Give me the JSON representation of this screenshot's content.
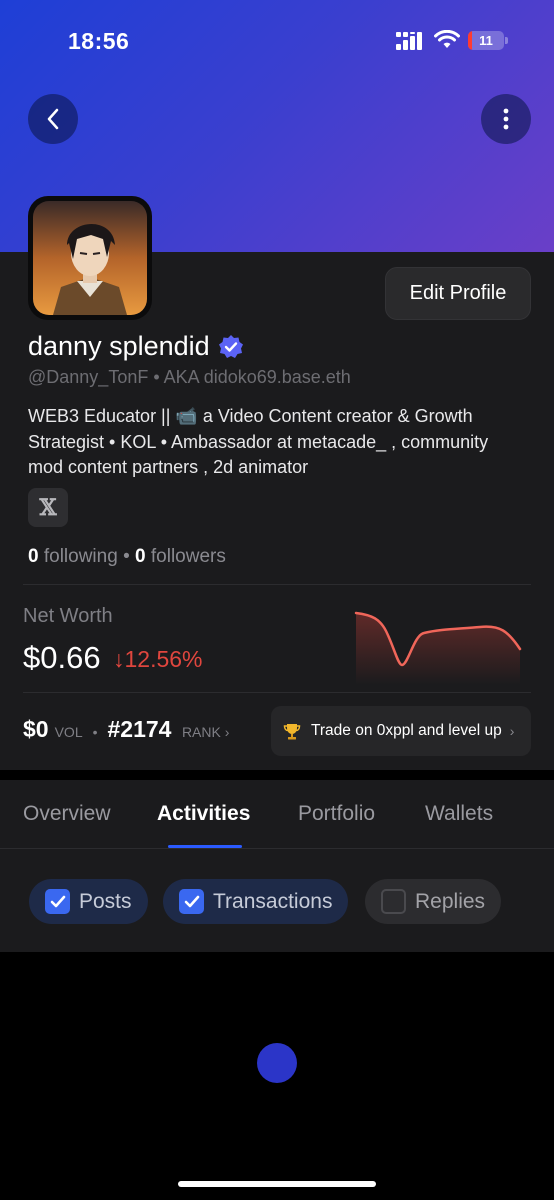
{
  "status_bar": {
    "time": "18:56",
    "battery": "11"
  },
  "profile": {
    "display_name": "danny splendid",
    "handle": "@Danny_TonF",
    "aka": "AKA didoko69.base.eth",
    "bio": "WEB3 Educator || 📹 a Video Content creator & Growth Strategist • KOL • Ambassador at metacade_ , community mod content partners , 2d animator",
    "edit_label": "Edit Profile",
    "social_icon": "x-logo",
    "following_count": "0",
    "following_label": "following",
    "followers_count": "0",
    "followers_label": "followers"
  },
  "net_worth": {
    "label": "Net Worth",
    "value": "$0.66",
    "change": "↓12.56%",
    "change_color": "#e0463e"
  },
  "stats": {
    "vol_value": "$0",
    "vol_label": "VOL",
    "rank_value": "#2174",
    "rank_label": "RANK ›",
    "trade_label": "Trade on 0xppl and level up",
    "trade_chevron": "›"
  },
  "tabs": [
    "Overview",
    "Activities",
    "Portfolio",
    "Wallets"
  ],
  "active_tab": "Activities",
  "filters": [
    {
      "label": "Posts",
      "checked": true
    },
    {
      "label": "Transactions",
      "checked": true
    },
    {
      "label": "Replies",
      "checked": false
    }
  ],
  "colors": {
    "accent": "#2b5bff",
    "negative": "#e0463e",
    "banner_start": "#1e3fd6",
    "banner_end": "#6a3fc8"
  }
}
